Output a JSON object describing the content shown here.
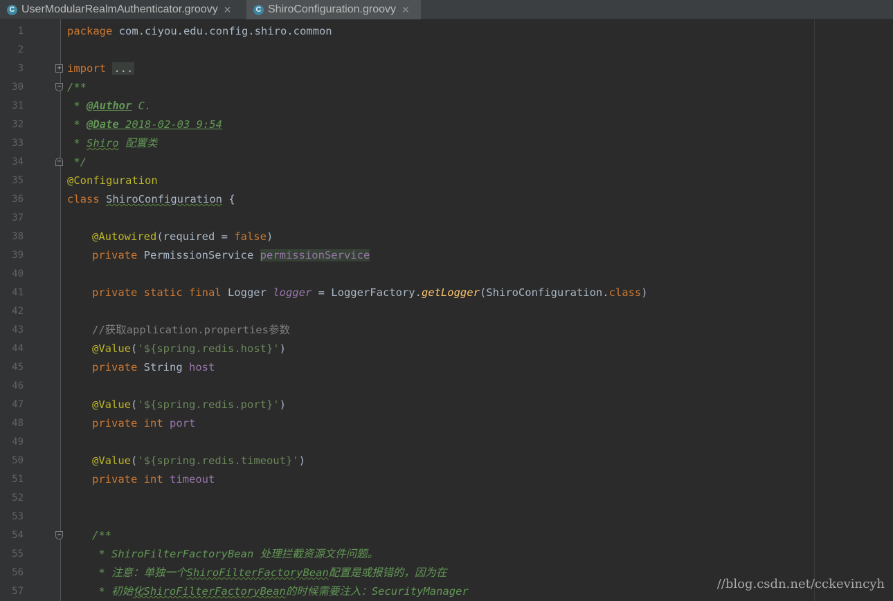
{
  "tabs": [
    {
      "label": "UserModularRealmAuthenticator.groovy",
      "icon": "C",
      "active": false
    },
    {
      "label": "ShiroConfiguration.groovy",
      "icon": "C",
      "active": true
    }
  ],
  "lines": [
    {
      "n": "1"
    },
    {
      "n": "2"
    },
    {
      "n": "3"
    },
    {
      "n": "30"
    },
    {
      "n": "31"
    },
    {
      "n": "32"
    },
    {
      "n": "33"
    },
    {
      "n": "34"
    },
    {
      "n": "35"
    },
    {
      "n": "36"
    },
    {
      "n": "37"
    },
    {
      "n": "38"
    },
    {
      "n": "39"
    },
    {
      "n": "40"
    },
    {
      "n": "41"
    },
    {
      "n": "42"
    },
    {
      "n": "43"
    },
    {
      "n": "44"
    },
    {
      "n": "45"
    },
    {
      "n": "46"
    },
    {
      "n": "47"
    },
    {
      "n": "48"
    },
    {
      "n": "49"
    },
    {
      "n": "50"
    },
    {
      "n": "51"
    },
    {
      "n": "52"
    },
    {
      "n": "53"
    },
    {
      "n": "54"
    },
    {
      "n": "55"
    },
    {
      "n": "56"
    },
    {
      "n": "57"
    }
  ],
  "code": {
    "l1": {
      "kw": "package",
      "rest": " com.ciyou.edu.config.shiro.common"
    },
    "l3": {
      "kw": "import",
      "folded": "..."
    },
    "l30": "/**",
    "l31": {
      "star": " * ",
      "tag": "@Author",
      "rest": " C."
    },
    "l32": {
      "star": " * ",
      "tag": "@Date",
      "rest": " 2018-02-03 9:54"
    },
    "l33": {
      "star": " * ",
      "word": "Shiro",
      "rest": " 配置类"
    },
    "l34": " */",
    "l35": "@Configuration",
    "l36": {
      "kw": "class",
      "name": "ShiroConfiguration",
      "rest": " {"
    },
    "l38": {
      "ann": "@Autowired",
      "open": "(required = ",
      "val": "false",
      "close": ")"
    },
    "l39": {
      "kw": "private",
      "type": " PermissionService ",
      "field": "permissionService"
    },
    "l41": {
      "kw": "private static final",
      "type": " Logger ",
      "field": "logger",
      "eq": " = LoggerFactory.",
      "meth": "getLogger",
      "args": "(ShiroConfiguration.",
      "cls": "class",
      "end": ")"
    },
    "l43": "//获取application.properties参数",
    "l44": {
      "ann": "@Value",
      "open": "(",
      "str": "'${spring.redis.host}'",
      "close": ")"
    },
    "l45": {
      "kw": "private",
      "type": " String ",
      "field": "host"
    },
    "l47": {
      "ann": "@Value",
      "open": "(",
      "str": "'${spring.redis.port}'",
      "close": ")"
    },
    "l48": {
      "kw": "private int",
      "field": "port"
    },
    "l50": {
      "ann": "@Value",
      "open": "(",
      "str": "'${spring.redis.timeout}'",
      "close": ")"
    },
    "l51": {
      "kw": "private int",
      "field": "timeout"
    },
    "l54": "/**",
    "l55": " * ShiroFilterFactoryBean 处理拦截资源文件问题。",
    "l56": {
      "a": " * 注意：单独一个",
      "b": "ShiroFilterFactoryBean",
      "c": "配置是或报错的，因为在"
    },
    "l57": {
      "a": " * 初始",
      "b": "化ShiroFilterFactoryBean",
      "c": "的时候需要注入：SecurityManager"
    }
  },
  "watermark": "//blog.csdn.net/cckevincyh",
  "colors": {
    "background": "#2b2b2b",
    "keyword": "#cc7832",
    "annotation": "#bbb529",
    "string": "#6a8759",
    "doc_comment": "#629755",
    "field": "#9876aa",
    "method": "#ffc66d",
    "comment": "#808080"
  }
}
